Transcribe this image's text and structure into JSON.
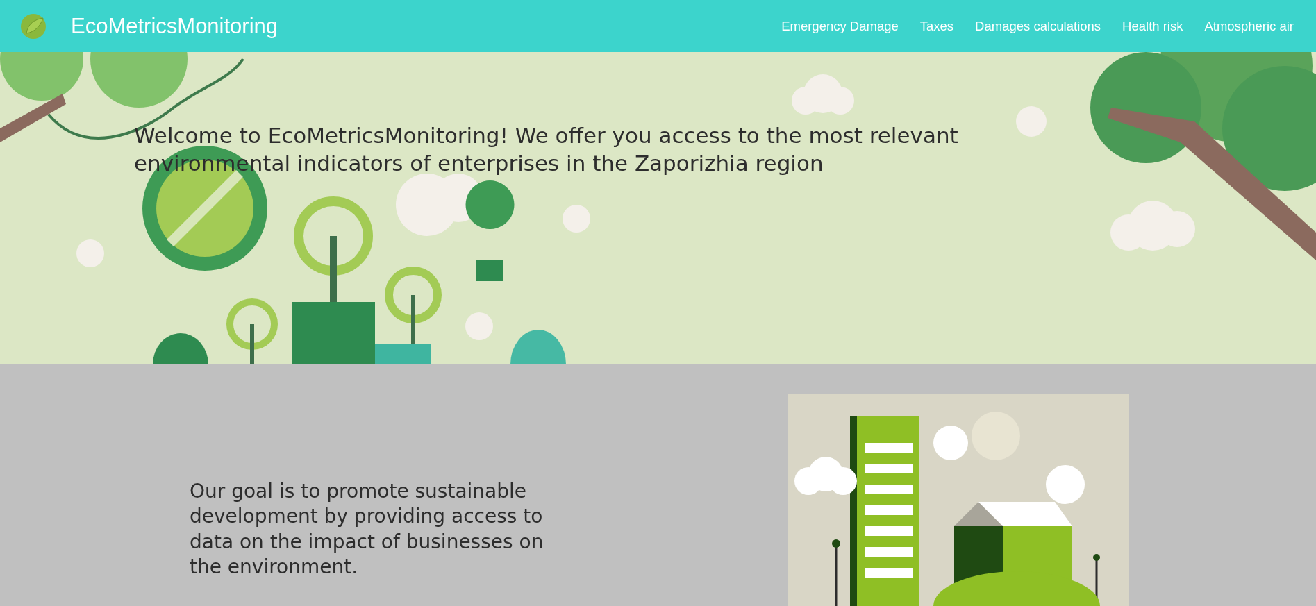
{
  "header": {
    "brand": "EcoMetricsMonitoring",
    "nav": [
      {
        "label": "Emergency Damage"
      },
      {
        "label": "Taxes"
      },
      {
        "label": "Damages calculations"
      },
      {
        "label": "Health risk"
      },
      {
        "label": "Atmospheric air"
      }
    ]
  },
  "hero": {
    "heading": "Welcome to EcoMetricsMonitoring! We offer you access to the most relevant environmental indicators of enterprises in the Zaporizhia region"
  },
  "goal": {
    "text": "Our goal is to promote sustainable development by providing access to data on the impact of businesses on the environment."
  }
}
